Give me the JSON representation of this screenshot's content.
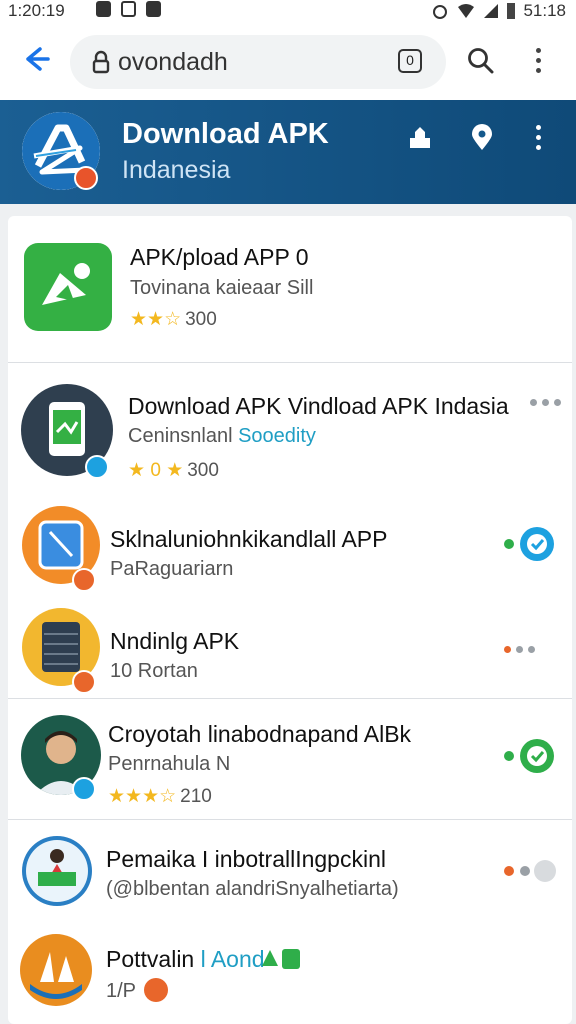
{
  "status_bar": {
    "time": "1:20:19",
    "clock_right": "51:18"
  },
  "browser": {
    "url": "ovondadh",
    "tab_count": "0"
  },
  "header": {
    "title": "Download APK",
    "subtitle": "Indanesia"
  },
  "apps": [
    {
      "name": "APK/pload APP 0",
      "subtitle": "Tovinana kaieaar Sill",
      "stars": "★★☆",
      "rating": "300",
      "icon_color": "#34b044"
    },
    {
      "name": "Download APK Vindload APK Indasia",
      "subtitle_plain": "Ceninsnlanl ",
      "subtitle_accent": "Sooedity",
      "stars": "★",
      "stars_middle": "0",
      "stars_tail": "★",
      "rating": "300",
      "icon_color": "#2f3f4f"
    },
    {
      "name": "Sklnaluniohnkikandlall APP",
      "subtitle": "PaRaguariarn",
      "icon_color": "#f28c28"
    },
    {
      "name": "Nndinlg APK",
      "subtitle": "10 Rortan",
      "icon_color": "#f2b72f"
    },
    {
      "name": "Croyotah linabodnapand AlBk",
      "subtitle": "Penrnahula N",
      "stars": "★★★☆",
      "rating": "210",
      "icon_color": "#1c5a4a"
    },
    {
      "name": "Pemaika I inbotrallIngpckinl",
      "subtitle": "(@blbentan alandriSnyalhetiarta)",
      "icon_color": "#2a7fc4"
    },
    {
      "name": "Pottvalin",
      "name_accent": "l Aond",
      "subtitle": "1/P",
      "icon_color": "#e98d1f"
    }
  ],
  "colors": {
    "accent": "#1a73e8",
    "header": "#14598c",
    "green": "#2fae4a",
    "orange": "#e8662b",
    "blue_badge": "#1da1e0"
  }
}
